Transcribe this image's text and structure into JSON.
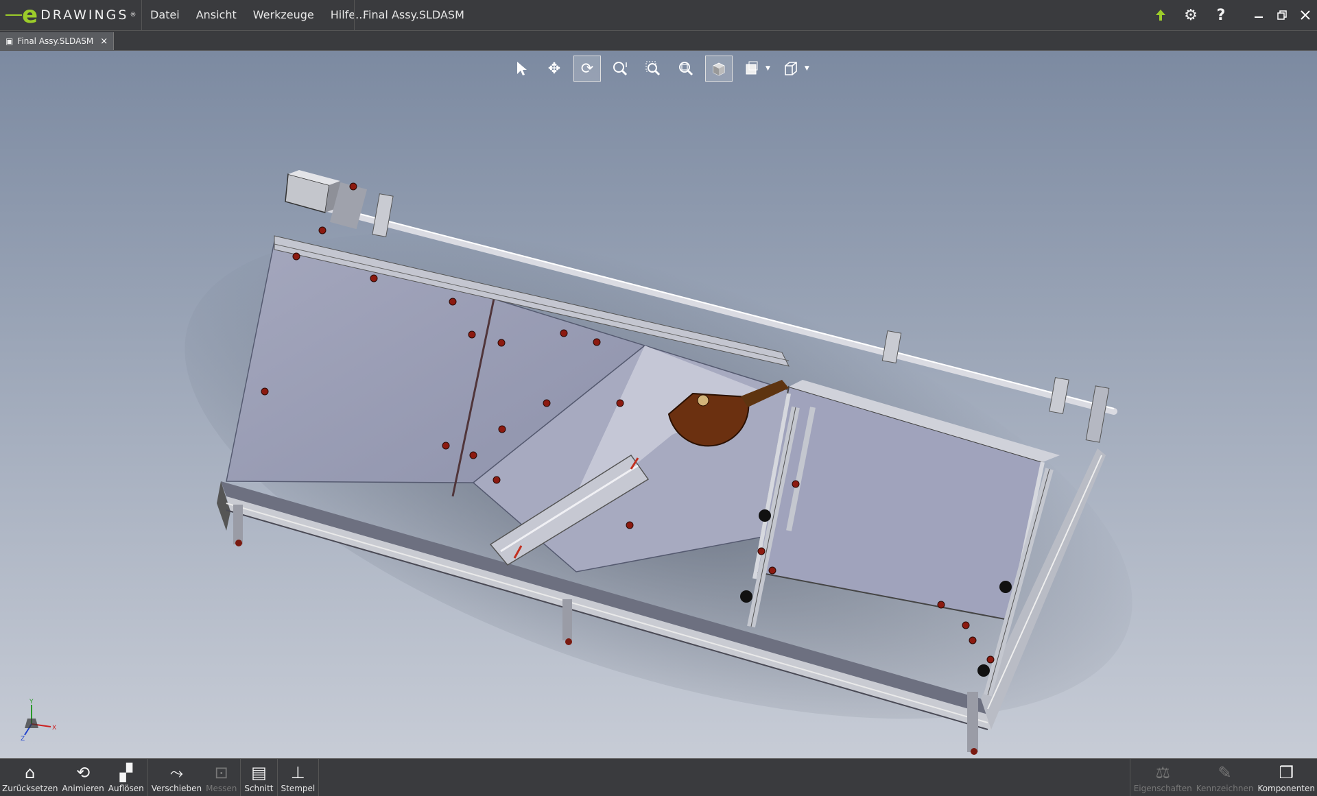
{
  "app": {
    "logo_letter": "e",
    "logo_word": "DRAWINGS",
    "logo_mark": "®",
    "document_title": "Final Assy.SLDASM"
  },
  "menu": {
    "items": [
      "Datei",
      "Ansicht",
      "Werkzeuge",
      "Hilfe..."
    ]
  },
  "titlebar_icons": [
    "update-arrow-icon",
    "gear-icon",
    "help-icon",
    "minimize-icon",
    "restore-icon",
    "close-icon"
  ],
  "tab": {
    "label": "Final Assy.SLDASM",
    "close": "×"
  },
  "view_toolbar": {
    "active": [
      "rotate",
      "shaded"
    ],
    "tools": [
      "select",
      "pan",
      "rotate",
      "zoom",
      "zoom-to-area",
      "zoom-to-fit",
      "shaded",
      "view-style",
      "standard-views"
    ]
  },
  "triad": {
    "x": "X",
    "y": "Y",
    "z": "Z"
  },
  "bottom_toolbar": {
    "left": [
      {
        "label": "Zurücksetzen",
        "icon": "home-icon",
        "enabled": true
      },
      {
        "label": "Animieren",
        "icon": "animate-icon",
        "enabled": true
      },
      {
        "label": "Auflösen",
        "icon": "explode-icon",
        "enabled": true
      },
      {
        "label": "Verschieben",
        "icon": "move-icon",
        "enabled": true
      },
      {
        "label": "Messen",
        "icon": "measure-icon",
        "enabled": false
      },
      {
        "label": "Schnitt",
        "icon": "section-icon",
        "enabled": true
      },
      {
        "label": "Stempel",
        "icon": "stamp-icon",
        "enabled": true
      }
    ],
    "right": [
      {
        "label": "Eigenschaften",
        "icon": "scale-icon",
        "enabled": false
      },
      {
        "label": "Kennzeichnen",
        "icon": "pencil-icon",
        "enabled": false
      },
      {
        "label": "Komponenten",
        "icon": "components-icon",
        "enabled": true
      }
    ]
  },
  "colors": {
    "accent_green": "#9ccc2a",
    "chrome": "#3a3b3e",
    "viewport_top": "#7c8aa1",
    "viewport_bottom": "#c7ccd6"
  }
}
